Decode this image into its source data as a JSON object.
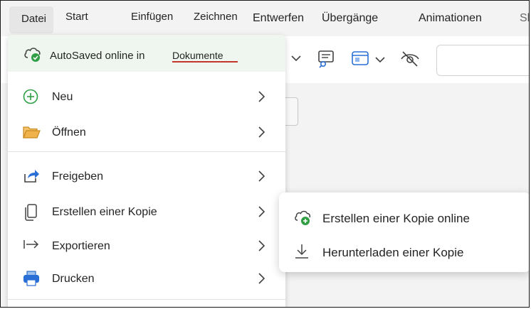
{
  "ribbon": {
    "tabs": [
      {
        "label": "Datei"
      },
      {
        "label": "Start"
      },
      {
        "label": "Einfügen"
      },
      {
        "label": "Zeichnen"
      },
      {
        "label": "Entwerfen"
      },
      {
        "label": "Übergänge"
      },
      {
        "label": "Animationen"
      },
      {
        "label": "Sl"
      }
    ]
  },
  "backstage": {
    "autosave_text": "AutoSaved online in",
    "autosave_location": "Dokumente",
    "items": [
      {
        "label": "Neu",
        "icon": "plus-circle-icon"
      },
      {
        "label": "Öffnen",
        "icon": "folder-open-icon"
      },
      {
        "label": "Freigeben",
        "icon": "share-icon"
      },
      {
        "label": "Erstellen einer Kopie",
        "icon": "copy-icon"
      },
      {
        "label": "Exportieren",
        "icon": "export-arrow-icon"
      },
      {
        "label": "Drucken",
        "icon": "printer-icon"
      }
    ]
  },
  "copy_submenu": {
    "items": [
      {
        "label": "Erstellen einer Kopie online",
        "icon": "cloud-add-icon"
      },
      {
        "label": "Herunterladen einer Kopie",
        "icon": "download-icon"
      }
    ]
  },
  "colors": {
    "accent_green": "#2f9e44",
    "underline_red": "#c4362a",
    "folder_orange": "#e8a23a",
    "share_blue": "#2a6fd6"
  }
}
